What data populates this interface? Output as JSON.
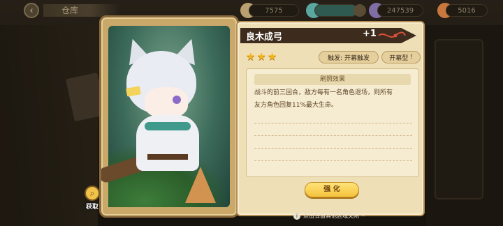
{
  "topbar": {
    "title": "仓库",
    "currency_1": "7575",
    "currency_2": "",
    "currency_3": "247539",
    "currency_4": "5016",
    "back_icon": "back-arrow-icon"
  },
  "card": {
    "acquire_label": "获取",
    "acquire_icon": "magnifier-icon"
  },
  "panel": {
    "name": "良木成弓",
    "level": "+1",
    "stars": 3,
    "star_glyphs": [
      "★",
      "★",
      "★"
    ],
    "trigger_tag": "触发: 开幕触发",
    "type_tag": "开幕型",
    "effect_title": "刷照效果",
    "effect_lines": [
      "战斗的前三回合，敌方每有一名角色退场，则所有",
      "友方角色回复11%最大生命。"
    ],
    "upgrade_label": "强 化"
  },
  "hint": {
    "text": "点击弹窗其他区域关闭 ~"
  },
  "colors": {
    "star": "#f3b41a",
    "banner": "#3d2c1e",
    "panel": "#efdfb6",
    "upgrade": "#f5c33d"
  }
}
